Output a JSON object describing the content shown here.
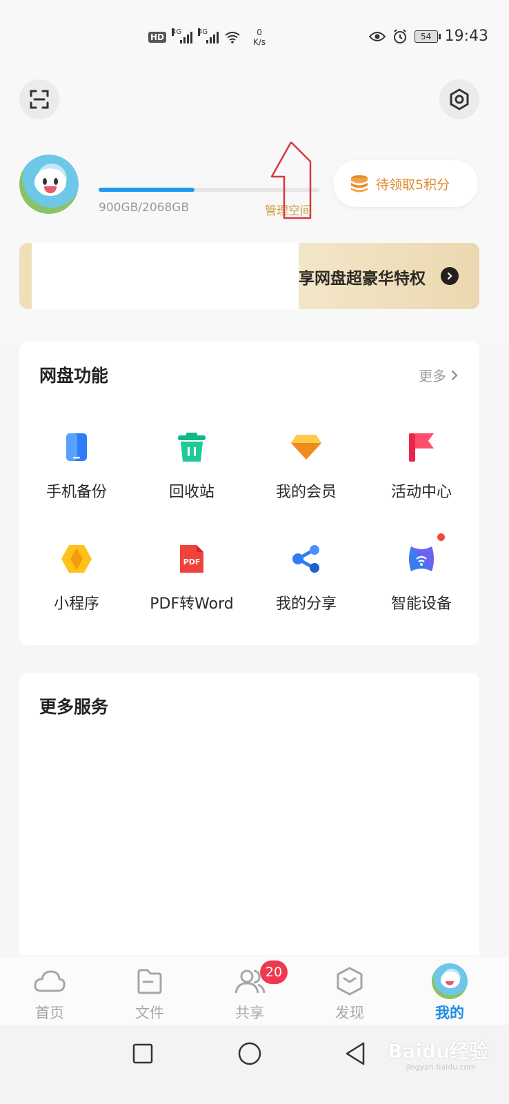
{
  "status_bar": {
    "hd": "HD",
    "net_type_1": "4G",
    "net_type_2": "4G",
    "speed_value": "0",
    "speed_unit": "K/s",
    "battery": "54",
    "time": "19:43"
  },
  "header": {
    "scan_icon": "scan-icon",
    "settings_icon": "settings-hexagon-icon"
  },
  "profile": {
    "storage_used_ratio": 0.435,
    "storage_text": "900GB/2068GB",
    "manage_label": "管理空间",
    "points_label": "待领取5积分"
  },
  "banner": {
    "text": "享网盘超豪华特权"
  },
  "features": {
    "title": "网盘功能",
    "more_label": "更多",
    "items": [
      {
        "label": "手机备份",
        "icon": "phone-backup-icon"
      },
      {
        "label": "回收站",
        "icon": "trash-icon"
      },
      {
        "label": "我的会员",
        "icon": "diamond-icon"
      },
      {
        "label": "活动中心",
        "icon": "flag-icon"
      },
      {
        "label": "小程序",
        "icon": "mini-program-icon"
      },
      {
        "label": "PDF转Word",
        "icon": "pdf-icon"
      },
      {
        "label": "我的分享",
        "icon": "share-icon"
      },
      {
        "label": "智能设备",
        "icon": "smart-device-icon"
      }
    ],
    "pdf_badge": "PDF"
  },
  "services": {
    "title": "更多服务"
  },
  "tabs": [
    {
      "label": "首页",
      "icon": "cloud-icon"
    },
    {
      "label": "文件",
      "icon": "folder-icon"
    },
    {
      "label": "共享",
      "icon": "people-icon",
      "badge": "20"
    },
    {
      "label": "发现",
      "icon": "cube-icon"
    },
    {
      "label": "我的",
      "icon": "avatar",
      "active": true
    }
  ],
  "watermark": {
    "main": "Baidu经验",
    "sub": "jingyan.baidu.com"
  },
  "colors": {
    "accent_blue": "#1e8fe0",
    "gold": "#c89a33",
    "points_orange": "#e08a2d",
    "badge_red": "#f0384e"
  }
}
